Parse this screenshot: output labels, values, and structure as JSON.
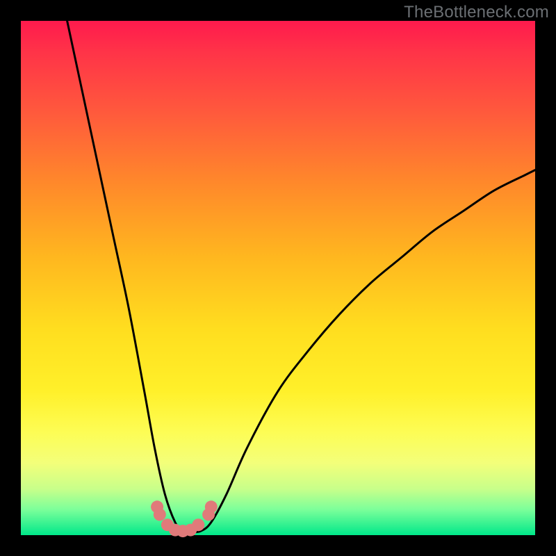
{
  "watermark": "TheBottleneck.com",
  "chart_data": {
    "type": "line",
    "title": "",
    "xlabel": "",
    "ylabel": "",
    "xlim": [
      0,
      100
    ],
    "ylim": [
      0,
      100
    ],
    "note": "V-shaped bottleneck percentage curve. Axes are normalized 0–100; positions estimated from pixels (no tick labels visible).",
    "series": [
      {
        "name": "bottleneck-curve",
        "x": [
          9,
          12,
          15,
          18,
          21,
          24,
          26,
          28,
          30,
          31.5,
          33,
          35,
          37,
          40,
          44,
          50,
          56,
          62,
          68,
          74,
          80,
          86,
          92,
          98,
          100
        ],
        "y": [
          100,
          86,
          72,
          58,
          44,
          28,
          17,
          8,
          2.5,
          0.8,
          0.6,
          0.8,
          2.5,
          8,
          17,
          28,
          36,
          43,
          49,
          54,
          59,
          63,
          67,
          70,
          71
        ]
      }
    ],
    "markers": {
      "name": "highlighted-points",
      "note": "Pink circular markers clustered near the curve minimum.",
      "x": [
        26.5,
        27,
        28.5,
        30,
        31.5,
        33,
        34.5,
        36.5,
        37
      ],
      "y": [
        5.5,
        4,
        2,
        1,
        0.8,
        1,
        2,
        4,
        5.5
      ]
    },
    "colors": {
      "curve": "#000000",
      "markers": "#e07a7a",
      "gradient_top": "#ff1a4d",
      "gradient_bottom": "#00e88a",
      "frame": "#000000"
    }
  }
}
